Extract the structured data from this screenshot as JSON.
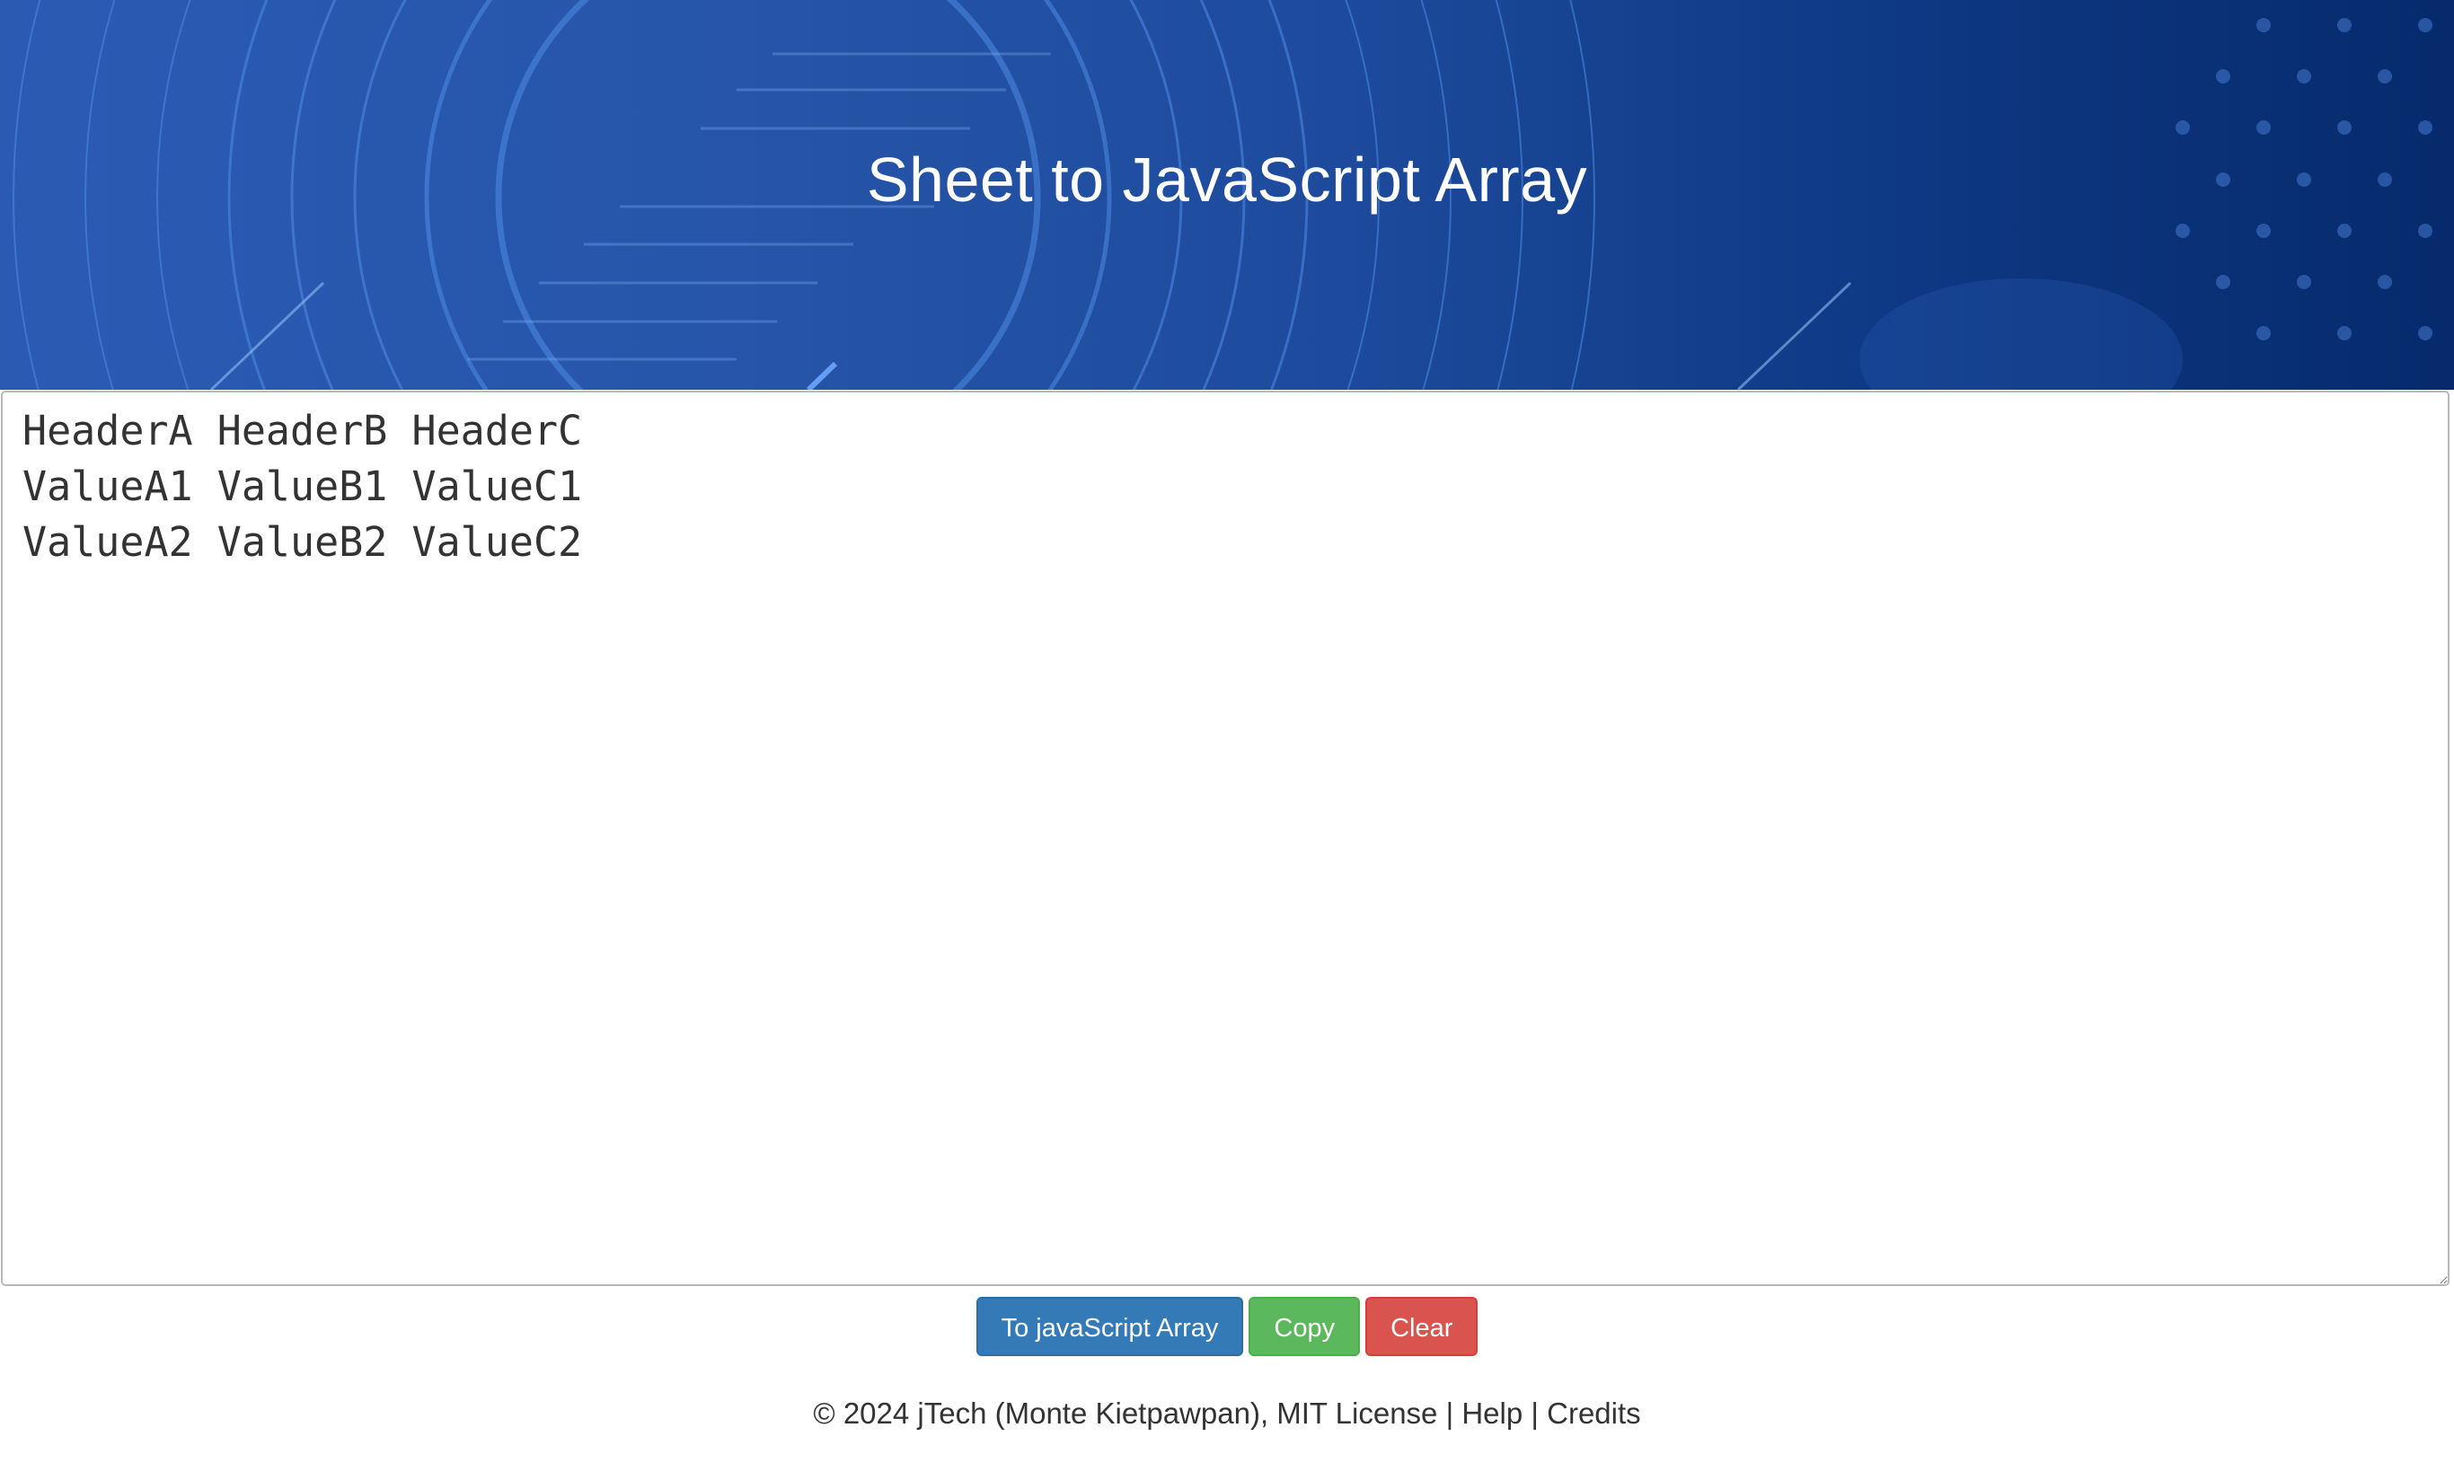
{
  "header": {
    "title": "Sheet to JavaScript Array"
  },
  "sheet": {
    "content": "HeaderA HeaderB HeaderC\nValueA1 ValueB1 ValueC1\nValueA2 ValueB2 ValueC2"
  },
  "toolbar": {
    "convert_label": "To javaScript Array",
    "copy_label": "Copy",
    "clear_label": "Clear"
  },
  "footer": {
    "copyright": "© 2024 jTech (Monte Kietpawpan), MIT License",
    "separator": "|",
    "help_label": "Help",
    "credits_label": "Credits"
  },
  "colors": {
    "primary": "#337ab7",
    "success": "#5cb85c",
    "danger": "#d9534f"
  }
}
